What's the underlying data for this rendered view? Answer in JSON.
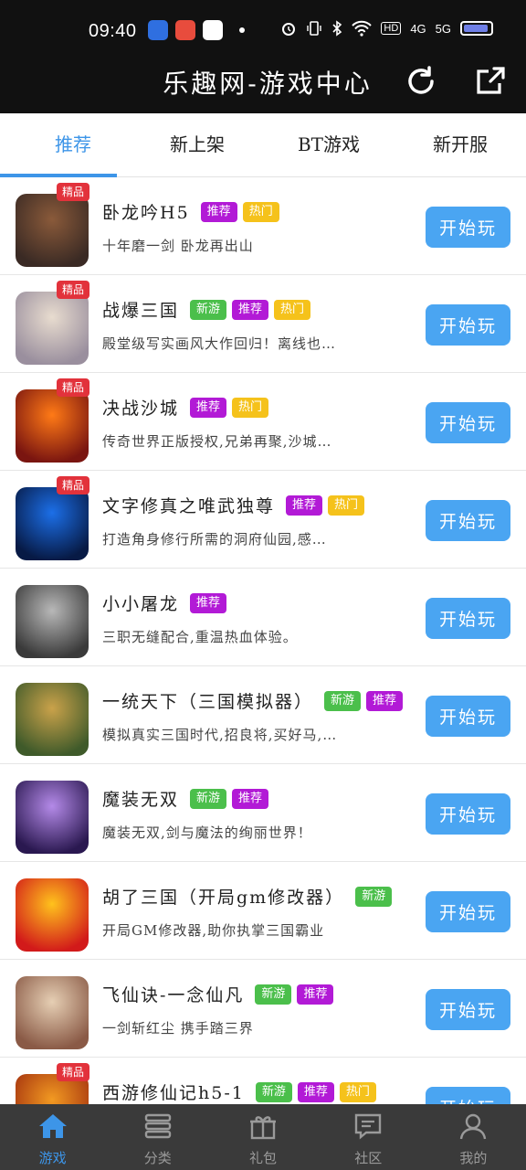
{
  "status_bar": {
    "time": "09:40",
    "indicators": [
      "alarm-icon",
      "vibrate-icon",
      "bluetooth-icon",
      "wifi-icon"
    ],
    "hd_label": "HD",
    "net1": "4G",
    "net2": "5G"
  },
  "header": {
    "title": "乐趣网-游戏中心",
    "refresh_icon": "refresh-icon",
    "share_icon": "share-icon"
  },
  "tabs": [
    {
      "label": "推荐",
      "active": true
    },
    {
      "label": "新上架",
      "active": false
    },
    {
      "label": "BT游戏",
      "active": false
    },
    {
      "label": "新开服",
      "active": false
    }
  ],
  "games": [
    {
      "name": "卧龙吟H5",
      "badge": "精品",
      "tags": [
        "推荐",
        "热门"
      ],
      "desc": "十年磨一剑 卧龙再出山",
      "button": "开始玩",
      "colors": [
        "#8a5a3a",
        "#3a2a24"
      ]
    },
    {
      "name": "战爆三国",
      "badge": "精品",
      "tags": [
        "新游",
        "推荐",
        "热门"
      ],
      "desc": "殿堂级写实画风大作回归！离线也…",
      "button": "开始玩",
      "colors": [
        "#e8dccf",
        "#9a8f9e"
      ]
    },
    {
      "name": "决战沙城",
      "badge": "精品",
      "tags": [
        "推荐",
        "热门"
      ],
      "desc": "传奇世界正版授权,兄弟再聚,沙城…",
      "button": "开始玩",
      "colors": [
        "#ff7a16",
        "#7a1510"
      ]
    },
    {
      "name": "文字修真之唯武独尊",
      "badge": "精品",
      "tags": [
        "推荐",
        "热门"
      ],
      "desc": "打造角身修行所需的洞府仙园,感…",
      "button": "开始玩",
      "colors": [
        "#1c6fe8",
        "#071a45"
      ]
    },
    {
      "name": "小小屠龙",
      "badge": "",
      "tags": [
        "推荐"
      ],
      "desc": "三职无缝配合,重温热血体验。",
      "button": "开始玩",
      "colors": [
        "#b8b8b8",
        "#3a3a3a"
      ]
    },
    {
      "name": "一统天下（三国模拟器）",
      "badge": "",
      "tags": [
        "新游",
        "推荐"
      ],
      "desc": "模拟真实三国时代,招良将,买好马,…",
      "button": "开始玩",
      "colors": [
        "#caa24a",
        "#3f5a2a"
      ]
    },
    {
      "name": "魔装无双",
      "badge": "",
      "tags": [
        "新游",
        "推荐"
      ],
      "desc": "魔装无双,剑与魔法的绚丽世界！",
      "button": "开始玩",
      "colors": [
        "#b48ae8",
        "#2a1850"
      ]
    },
    {
      "name": "胡了三国（开局gm修改器）",
      "badge": "",
      "tags": [
        "新游"
      ],
      "desc": "开局GM修改器,助你执掌三国霸业",
      "button": "开始玩",
      "colors": [
        "#ffc21c",
        "#d21a1a"
      ]
    },
    {
      "name": "飞仙诀-一念仙凡",
      "badge": "",
      "tags": [
        "新游",
        "推荐"
      ],
      "desc": "一剑斩红尘 携手踏三界",
      "button": "开始玩",
      "colors": [
        "#e6cfb4",
        "#8a5a46"
      ]
    },
    {
      "name": "西游修仙记h5-1",
      "badge": "精品",
      "tags": [
        "新游",
        "推荐",
        "热门"
      ],
      "desc": "",
      "button": "开始玩",
      "colors": [
        "#f29a22",
        "#a3300e"
      ]
    }
  ],
  "bottom_nav": [
    {
      "label": "游戏",
      "icon": "home-icon",
      "active": true
    },
    {
      "label": "分类",
      "icon": "list-icon",
      "active": false
    },
    {
      "label": "礼包",
      "icon": "gift-icon",
      "active": false
    },
    {
      "label": "社区",
      "icon": "chat-icon",
      "active": false
    },
    {
      "label": "我的",
      "icon": "user-icon",
      "active": false
    }
  ]
}
